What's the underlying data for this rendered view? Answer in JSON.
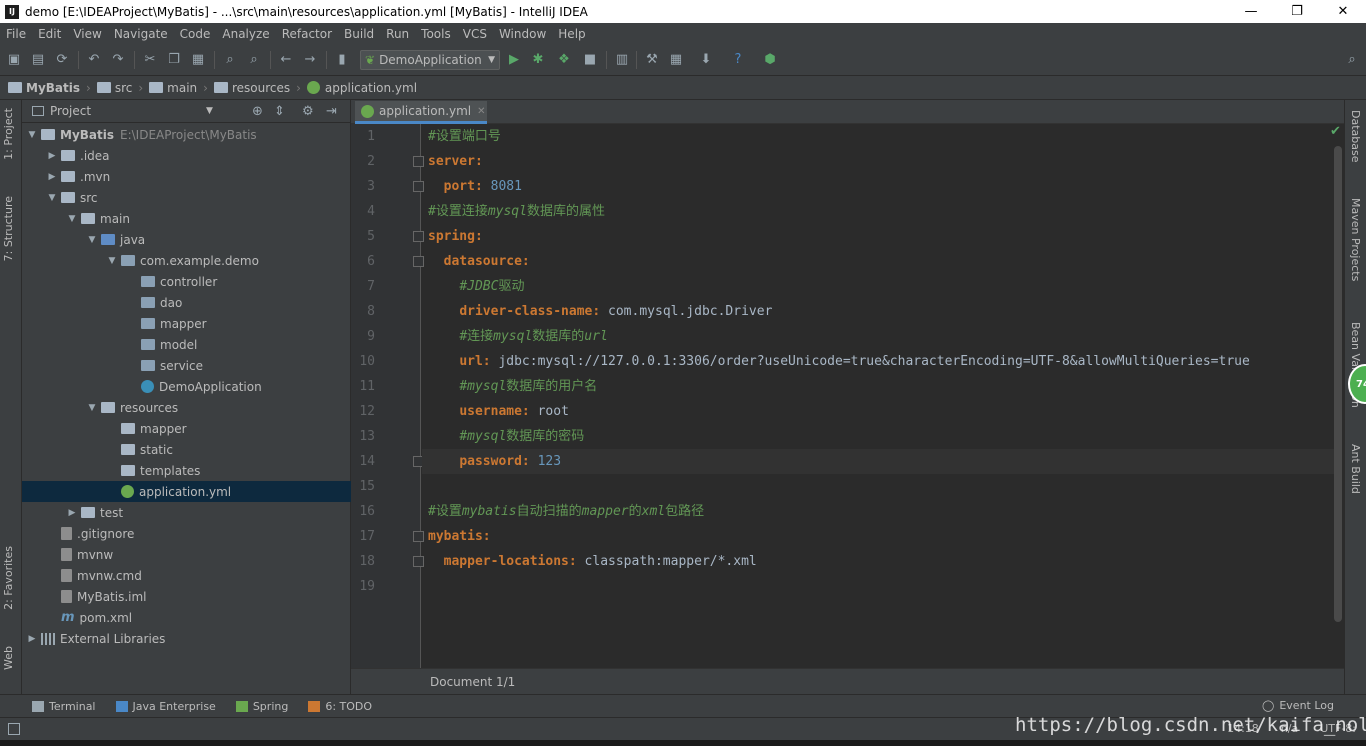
{
  "window": {
    "title": "demo [E:\\IDEAProject\\MyBatis] - ...\\src\\main\\resources\\application.yml [MyBatis] - IntelliJ IDEA",
    "app_icon": "IJ",
    "minimize": "—",
    "restore": "❐",
    "close": "✕"
  },
  "menu": [
    "File",
    "Edit",
    "View",
    "Navigate",
    "Code",
    "Analyze",
    "Refactor",
    "Build",
    "Run",
    "Tools",
    "VCS",
    "Window",
    "Help"
  ],
  "toolbar": {
    "run_config": "DemoApplication"
  },
  "breadcrumb": [
    "MyBatis",
    "src",
    "main",
    "resources",
    "application.yml"
  ],
  "left_tabs": {
    "project": "1: Project",
    "structure": "7: Structure",
    "favorites": "2: Favorites",
    "web": "Web"
  },
  "right_tabs": {
    "database": "Database",
    "maven": "Maven Projects",
    "bean": "Bean Validation",
    "ant": "Ant Build"
  },
  "badge": "74",
  "project": {
    "header": "Project",
    "tree": [
      {
        "label": "MyBatis",
        "hint": "E:\\IDEAProject\\MyBatis",
        "depth": 0,
        "arrow": "▼",
        "icon": "folder"
      },
      {
        "label": ".idea",
        "depth": 1,
        "arrow": "▶",
        "icon": "folder"
      },
      {
        "label": ".mvn",
        "depth": 1,
        "arrow": "▶",
        "icon": "folder"
      },
      {
        "label": "src",
        "depth": 1,
        "arrow": "▼",
        "icon": "folder"
      },
      {
        "label": "main",
        "depth": 2,
        "arrow": "▼",
        "icon": "folder"
      },
      {
        "label": "java",
        "depth": 3,
        "arrow": "▼",
        "icon": "folder-blue"
      },
      {
        "label": "com.example.demo",
        "depth": 4,
        "arrow": "▼",
        "icon": "package"
      },
      {
        "label": "controller",
        "depth": 5,
        "arrow": "",
        "icon": "package"
      },
      {
        "label": "dao",
        "depth": 5,
        "arrow": "",
        "icon": "package"
      },
      {
        "label": "mapper",
        "depth": 5,
        "arrow": "",
        "icon": "package"
      },
      {
        "label": "model",
        "depth": 5,
        "arrow": "",
        "icon": "package"
      },
      {
        "label": "service",
        "depth": 5,
        "arrow": "",
        "icon": "package"
      },
      {
        "label": "DemoApplication",
        "depth": 5,
        "arrow": "",
        "icon": "class"
      },
      {
        "label": "resources",
        "depth": 3,
        "arrow": "▼",
        "icon": "folder"
      },
      {
        "label": "mapper",
        "depth": 4,
        "arrow": "",
        "icon": "folder"
      },
      {
        "label": "static",
        "depth": 4,
        "arrow": "",
        "icon": "folder"
      },
      {
        "label": "templates",
        "depth": 4,
        "arrow": "",
        "icon": "folder"
      },
      {
        "label": "application.yml",
        "depth": 4,
        "arrow": "",
        "icon": "spring",
        "selected": true
      },
      {
        "label": "test",
        "depth": 2,
        "arrow": "▶",
        "icon": "folder"
      },
      {
        "label": ".gitignore",
        "depth": 1,
        "arrow": "",
        "icon": "file"
      },
      {
        "label": "mvnw",
        "depth": 1,
        "arrow": "",
        "icon": "file"
      },
      {
        "label": "mvnw.cmd",
        "depth": 1,
        "arrow": "",
        "icon": "file"
      },
      {
        "label": "MyBatis.iml",
        "depth": 1,
        "arrow": "",
        "icon": "file"
      },
      {
        "label": "pom.xml",
        "depth": 1,
        "arrow": "",
        "icon": "maven"
      },
      {
        "label": "External Libraries",
        "depth": 0,
        "arrow": "▶",
        "icon": "libs"
      }
    ]
  },
  "editor": {
    "tab": "application.yml",
    "status": "Document 1/1",
    "lines": [
      {
        "n": "1",
        "parts": [
          [
            "cmz",
            "#设置端口号"
          ]
        ]
      },
      {
        "n": "2",
        "parts": [
          [
            "key",
            "server:"
          ]
        ]
      },
      {
        "n": "3",
        "parts": [
          [
            "val",
            "  "
          ],
          [
            "key",
            "port:"
          ],
          [
            "val",
            " "
          ],
          [
            "num",
            "8081"
          ]
        ]
      },
      {
        "n": "4",
        "parts": [
          [
            "cmz",
            "#设置连接"
          ],
          [
            "cm",
            "mysql"
          ],
          [
            "cmz",
            "数据库的属性"
          ]
        ]
      },
      {
        "n": "5",
        "parts": [
          [
            "key",
            "spring:"
          ]
        ]
      },
      {
        "n": "6",
        "parts": [
          [
            "val",
            "  "
          ],
          [
            "key",
            "datasource:"
          ]
        ]
      },
      {
        "n": "7",
        "parts": [
          [
            "val",
            "    "
          ],
          [
            "cm",
            "#JDBC"
          ],
          [
            "cmz",
            "驱动"
          ]
        ]
      },
      {
        "n": "8",
        "parts": [
          [
            "val",
            "    "
          ],
          [
            "key",
            "driver-class-name:"
          ],
          [
            "val",
            " com.mysql.jdbc.Driver"
          ]
        ]
      },
      {
        "n": "9",
        "parts": [
          [
            "val",
            "    "
          ],
          [
            "cmz",
            "#连接"
          ],
          [
            "cm",
            "mysql"
          ],
          [
            "cmz",
            "数据库的"
          ],
          [
            "cm",
            "url"
          ]
        ]
      },
      {
        "n": "10",
        "parts": [
          [
            "val",
            "    "
          ],
          [
            "key",
            "url:"
          ],
          [
            "val",
            " jdbc:mysql://127.0.0.1:3306/order?useUnicode=true&characterEncoding=UTF-8&allowMultiQueries=true"
          ]
        ]
      },
      {
        "n": "11",
        "parts": [
          [
            "val",
            "    "
          ],
          [
            "cm",
            "#mysql"
          ],
          [
            "cmz",
            "数据库的用户名"
          ]
        ]
      },
      {
        "n": "12",
        "parts": [
          [
            "val",
            "    "
          ],
          [
            "key",
            "username:"
          ],
          [
            "val",
            " root"
          ]
        ]
      },
      {
        "n": "13",
        "parts": [
          [
            "val",
            "    "
          ],
          [
            "cm",
            "#mysql"
          ],
          [
            "cmz",
            "数据库的密码"
          ]
        ]
      },
      {
        "n": "14",
        "parts": [
          [
            "val",
            "    "
          ],
          [
            "key",
            "password:"
          ],
          [
            "val",
            " "
          ],
          [
            "num",
            "123"
          ]
        ],
        "current": true
      },
      {
        "n": "15",
        "parts": []
      },
      {
        "n": "16",
        "parts": [
          [
            "cmz",
            "#设置"
          ],
          [
            "cm",
            "mybatis"
          ],
          [
            "cmz",
            "自动扫描的"
          ],
          [
            "cm",
            "mapper"
          ],
          [
            "cmz",
            "的"
          ],
          [
            "cm",
            "xml"
          ],
          [
            "cmz",
            "包路径"
          ]
        ]
      },
      {
        "n": "17",
        "parts": [
          [
            "key",
            "mybatis:"
          ]
        ]
      },
      {
        "n": "18",
        "parts": [
          [
            "val",
            "  "
          ],
          [
            "key",
            "mapper-locations:"
          ],
          [
            "val",
            " classpath:mapper/*.xml"
          ]
        ]
      },
      {
        "n": "19",
        "parts": []
      }
    ]
  },
  "bottom_tabs": [
    "Terminal",
    "Java Enterprise",
    "Spring",
    "6: TODO"
  ],
  "event_log": "Event Log",
  "statusbar": {
    "position": "14:18",
    "line_sep": "n/a",
    "encoding": "UTF-8:"
  },
  "watermark": "https://blog.csdn.net/kaifa_nolie"
}
